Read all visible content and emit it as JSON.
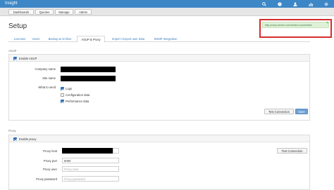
{
  "app": {
    "brand": "Insight"
  },
  "topbar": {
    "icons": [
      "search-icon",
      "help-icon",
      "user-icon",
      "chart-icon",
      "gear-icon"
    ]
  },
  "nav": {
    "items": [
      "Dashboards",
      "Queries",
      "Manage",
      "Admin"
    ]
  },
  "page": {
    "title": "Setup"
  },
  "toast": {
    "message": "http proxy server connection successful",
    "close": "×"
  },
  "tabs": [
    "Licenses",
    "Users",
    "Backup & Archive",
    "ASUP & Proxy",
    "Import / Export user data",
    "SNMP Integration"
  ],
  "active_tab": "ASUP & Proxy",
  "asup": {
    "section_label": "ASUP",
    "enable_label": "Enable ASUP",
    "enabled": true,
    "company_label": "Company name",
    "site_label": "Site name",
    "what_label": "What to send",
    "options": [
      {
        "label": "Logs",
        "checked": true
      },
      {
        "label": "Configuration data",
        "checked": false
      },
      {
        "label": "Performance data",
        "checked": true
      }
    ],
    "test_button": "Test Connection",
    "save_button": "Save"
  },
  "proxy": {
    "section_label": "Proxy",
    "enable_label": "Enable proxy",
    "enabled": true,
    "host_label": "Proxy host",
    "port_label": "Proxy port",
    "port_value": "8080",
    "user_label": "Proxy user",
    "user_placeholder": "Proxy User",
    "password_label": "Proxy password",
    "password_placeholder": "Proxy password",
    "test_button": "Test Connection"
  },
  "colors": {
    "topbar": "#3d87c7",
    "toast_border": "#d62c2c",
    "toast_bg": "#dff0d8",
    "primary": "#6e9fd3"
  }
}
